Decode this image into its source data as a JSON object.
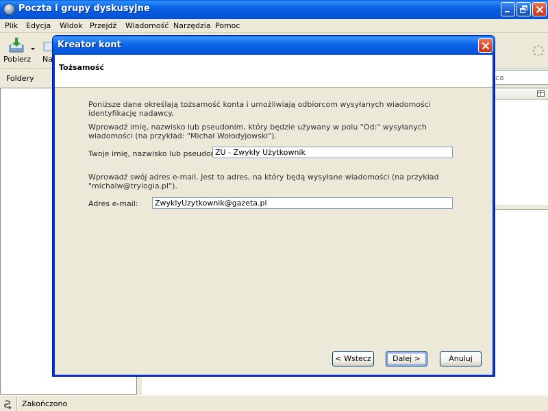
{
  "app": {
    "title": "Poczta i grupy dyskusyjne"
  },
  "menu": {
    "items": [
      "Plik",
      "Edycja",
      "Widok",
      "Przejdź",
      "Wiadomość",
      "Narzędzia",
      "Pomoc"
    ]
  },
  "toolbar": {
    "get_mail_label": "Pobierz",
    "next_label": "Na"
  },
  "folders": {
    "header": "Foldery"
  },
  "search": {
    "visible_text": "ca"
  },
  "status": {
    "text": "Zakończono"
  },
  "dialog": {
    "title": "Kreator kont",
    "page_heading": "Tożsamość",
    "intro": "Poniższe dane określają tożsamość konta i umożliwiają odbiorcom wysyłanych wiadomości identyfikację nadawcy.",
    "name_help": "Wprowadź imię, nazwisko lub pseudonim, który będzie używany w polu \"Od:\" wysyłanych wiadomości (na przykład: \"Michał Wołodyjowski\").",
    "name_label": "Twoje imię, nazwisko lub pseudonim:",
    "name_value": "ZU - Zwykły Użytkownik",
    "email_help": "Wprowadź swój adres e-mail. Jest to adres, na który będą wysyłane wiadomości (na przykład \"michalw@trylogia.pl\").",
    "email_label": "Adres e-mail:",
    "email_value": "ZwyklyUzytkownik@gazeta.pl",
    "back_label": "< Wstecz",
    "next_label": "Dalej >",
    "cancel_label": "Anuluj"
  },
  "colors": {
    "titlebar": "#0A5FE3",
    "window_bg": "#ECE9D8",
    "close_button": "#D6472B"
  },
  "icons": [
    "app-icon",
    "minimize-icon",
    "maximize-icon",
    "close-icon",
    "get-mail-icon",
    "dropdown-arrow-icon",
    "throbber-icon",
    "column-picker-icon",
    "status-icon"
  ]
}
